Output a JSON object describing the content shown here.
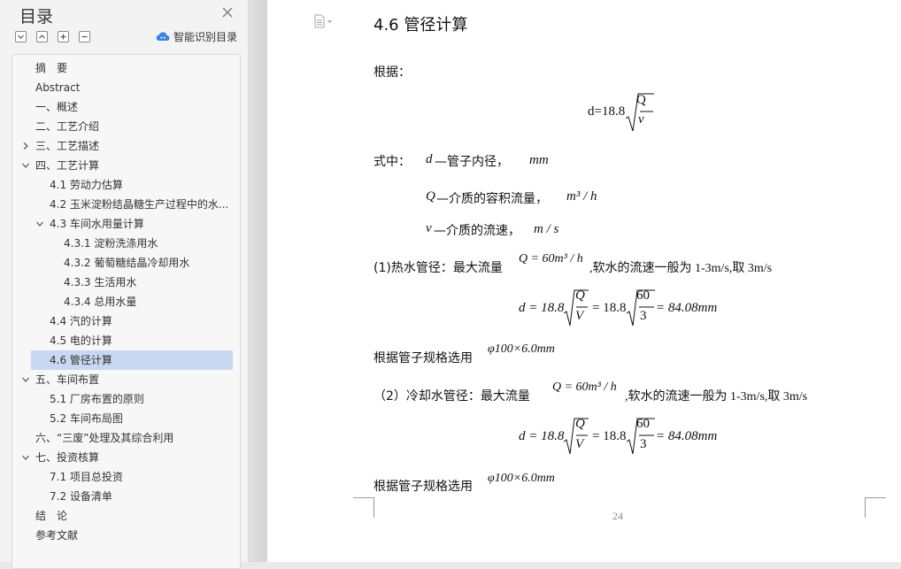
{
  "sidebar": {
    "title": "目录",
    "smart_toc_label": "智能识别目录",
    "items": [
      {
        "label": "摘　要"
      },
      {
        "label": "Abstract"
      },
      {
        "label": "一、概述"
      },
      {
        "label": "二、工艺介绍"
      },
      {
        "label": "三、工艺描述"
      },
      {
        "label": "四、工艺计算"
      },
      {
        "label": "4.1 劳动力估算"
      },
      {
        "label": "4.2 玉米淀粉结晶糖生产过程中的水..."
      },
      {
        "label": "4.3 车间水用量计算"
      },
      {
        "label": "4.3.1 淀粉洗涤用水"
      },
      {
        "label": "4.3.2  葡萄糖结晶冷却用水"
      },
      {
        "label": "4.3.3  生活用水"
      },
      {
        "label": "4.3.4  总用水量"
      },
      {
        "label": "4.4  汽的计算"
      },
      {
        "label": "4.5  电的计算"
      },
      {
        "label": "4.6  管径计算"
      },
      {
        "label": "五、车间布置"
      },
      {
        "label": "5.1 厂房布置的原则"
      },
      {
        "label": "5.2 车间布局图"
      },
      {
        "label": "六、“三废”处理及其综合利用"
      },
      {
        "label": "七、投资核算"
      },
      {
        "label": "7.1 项目总投资"
      },
      {
        "label": "7.2 设备清单"
      },
      {
        "label": "结　论"
      },
      {
        "label": "参考文献"
      }
    ],
    "active_item": "4.6  管径计算",
    "accent_color": "#c9d8f2"
  },
  "document": {
    "heading": "4.6  管径计算",
    "basis_label": "根据：",
    "formula_main": {
      "lhs": "d=18.8",
      "num": "Q",
      "den": "v"
    },
    "where_label": "式中：",
    "d_var": "d",
    "d_desc": "—管子内径，",
    "d_unit": "mm",
    "q_var": "Q",
    "q_desc": "—介质的容积流量，",
    "q_unit": "m³ / h",
    "v_var": "v",
    "v_desc": "—介质的流速，",
    "v_unit": "m / s",
    "item1_prefix": "(1)热水管径：最大流量",
    "item1_flow": "Q = 60m³ / h",
    "item1_suffix": ",软水的流速一般为 1-3m/s,取 3m/s",
    "calc1": {
      "lhs": "d = 18.8",
      "num1": "Q",
      "den1": "V",
      "mid": "= 18.8",
      "num2": "60",
      "den2": "3",
      "result": "= 84.08mm"
    },
    "select1_prefix": "根据管子规格选用",
    "select1_spec": "φ100×6.0mm",
    "item2_prefix": "（2）冷却水管径：最大流量",
    "item2_flow": "Q = 60m³ / h",
    "item2_suffix": ",软水的流速一般为 1-3m/s,取 3m/s",
    "calc2": {
      "lhs": "d = 18.8",
      "num1": "Q",
      "den1": "V",
      "mid": "= 18.8",
      "num2": "60",
      "den2": "3",
      "result": "= 84.08mm"
    },
    "select2_prefix": "根据管子规格选用",
    "select2_spec": "φ100×6.0mm",
    "page_number": "24"
  }
}
